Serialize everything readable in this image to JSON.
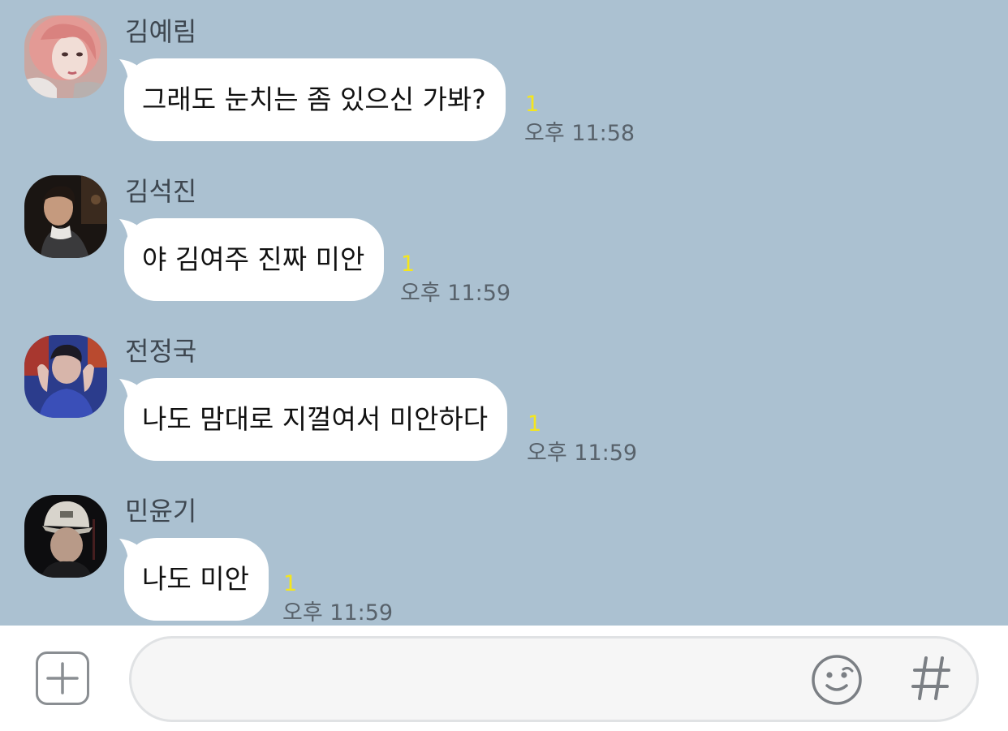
{
  "colors": {
    "chat_background": "#abc1d1",
    "bubble": "#ffffff",
    "unread_count": "#f5e61c",
    "timestamp": "#58626b",
    "sender_name": "#3e4750"
  },
  "messages": [
    {
      "sender": "김예림",
      "text": "그래도 눈치는 좀 있으신 가봐?",
      "unread": "1",
      "time": "오후 11:58"
    },
    {
      "sender": "김석진",
      "text": "야 김여주 진짜 미안",
      "unread": "1",
      "time": "오후 11:59"
    },
    {
      "sender": "전정국",
      "text": "나도 맘대로 지껄여서 미안하다",
      "unread": "1",
      "time": "오후 11:59"
    },
    {
      "sender": "민윤기",
      "text": "나도 미안",
      "unread": "1",
      "time": "오후 11:59"
    }
  ],
  "input_bar": {
    "message_value": "",
    "icons": [
      "plus-icon",
      "smiley-icon",
      "hashtag-icon"
    ]
  }
}
